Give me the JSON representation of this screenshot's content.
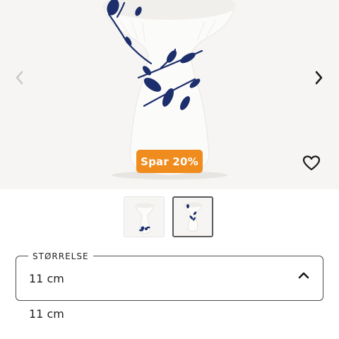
{
  "product": {
    "discount_badge": "Spar 20%",
    "colors": {
      "badge": "#f08c1e",
      "hero_background": "#f6f5f3",
      "decor_blue": "#1c2e6b"
    }
  },
  "gallery": {
    "icons": {
      "prev": "chevron-left-icon",
      "next": "chevron-right-icon",
      "wishlist": "heart-outline-icon"
    },
    "thumbnails": [
      {
        "selected": false
      },
      {
        "selected": true
      }
    ]
  },
  "size_selector": {
    "label": "STØRRELSE",
    "selected_value": "11 cm",
    "expanded": true,
    "icon": "chevron-up-icon",
    "options": [
      "11 cm"
    ]
  }
}
